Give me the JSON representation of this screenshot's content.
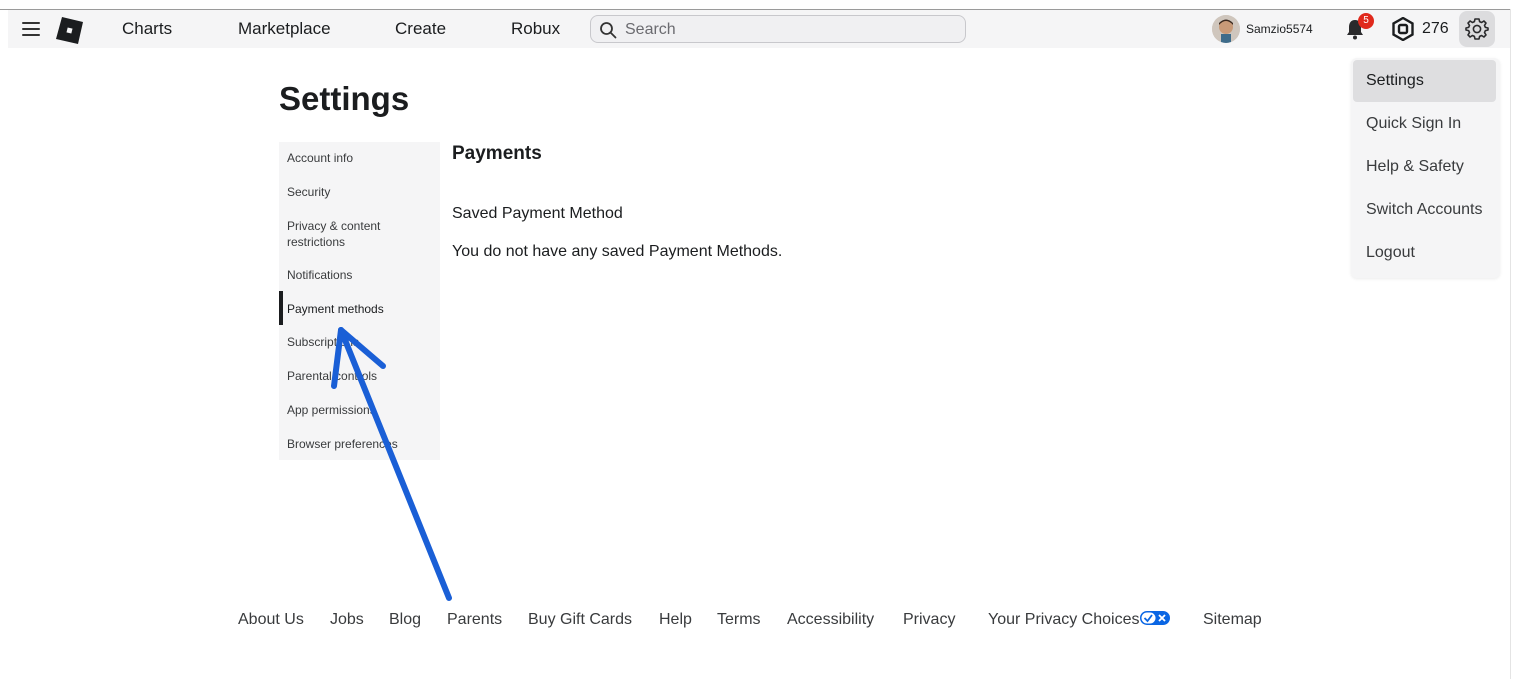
{
  "nav": {
    "links": [
      "Charts",
      "Marketplace",
      "Create",
      "Robux"
    ],
    "search_placeholder": "Search",
    "username": "Samzio5574",
    "notification_count": "5",
    "robux_balance": "276"
  },
  "settings_menu": {
    "items": [
      "Settings",
      "Quick Sign In",
      "Help & Safety",
      "Switch Accounts",
      "Logout"
    ],
    "active": "Settings"
  },
  "page": {
    "title": "Settings",
    "sidebar": [
      "Account info",
      "Security",
      "Privacy & content restrictions",
      "Notifications",
      "Payment methods",
      "Subscriptions",
      "Parental controls",
      "App permissions",
      "Browser preferences"
    ],
    "active_section": "Payment methods",
    "section_title": "Payments",
    "saved_payment_title": "Saved Payment Method",
    "saved_payment_message": "You do not have any saved Payment Methods."
  },
  "footer": {
    "links": [
      "About Us",
      "Jobs",
      "Blog",
      "Parents",
      "Buy Gift Cards",
      "Help",
      "Terms",
      "Accessibility",
      "Privacy",
      "Your Privacy Choices",
      "Sitemap"
    ]
  },
  "colors": {
    "annotation_arrow": "#1a5fd6",
    "notification_badge": "#e0291c",
    "privacy_choices_badge": "#0a66e4"
  }
}
